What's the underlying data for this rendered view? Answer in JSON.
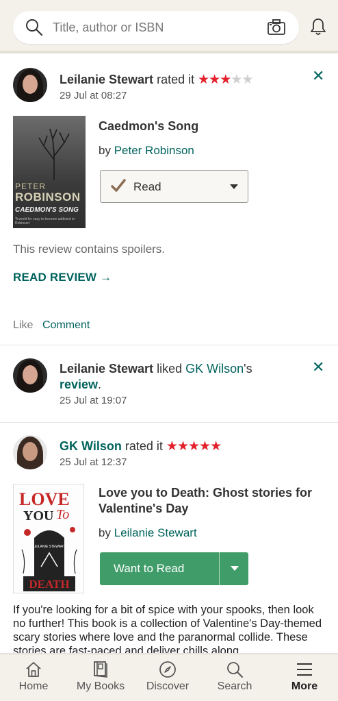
{
  "search": {
    "placeholder": "Title, author or ISBN"
  },
  "feed": {
    "item1": {
      "user": "Leilanie Stewart",
      "action": "rated it",
      "rating": 3,
      "timestamp": "29 Jul at 08:27",
      "book_title": "Caedmon's Song",
      "by": "by",
      "author": "Peter Robinson",
      "cover": {
        "line1": "PETER",
        "line2": "ROBINSON",
        "line3": "CAEDMON'S SONG",
        "line4": "'A world for easy to become addicted to Robinson'"
      },
      "shelf_label": "Read",
      "spoiler_text": "This review contains spoilers.",
      "read_review": "READ REVIEW →",
      "like": "Like",
      "comment": "Comment"
    },
    "item2": {
      "user": "Leilanie Stewart",
      "action": "liked",
      "target_user": "GK Wilson",
      "possessive": "'s",
      "target": "review",
      "period": ".",
      "timestamp": "25 Jul at 19:07"
    },
    "item3": {
      "user": "GK Wilson",
      "action": "rated it",
      "rating": 5,
      "timestamp": "25 Jul at 12:37",
      "book_title_line1": "Love you to Death: Ghost stories for",
      "book_title_line2": "Valentine's Day",
      "by": "by",
      "author": "Leilanie Stewart",
      "cover": {
        "line1": "LOVE",
        "line2": "YOU",
        "line3": "To",
        "line4": "DEATH",
        "line5": "LEILANIE STEWART"
      },
      "shelf_label": "Want to Read",
      "review_text": "If you're looking for a bit of spice with your spooks, then look no further! This book is a collection of Valentine's Day-themed scary stories where love and the paranormal collide. These stories are fast-paced and deliver chills along"
    }
  },
  "colors": {
    "accent": "#00635d",
    "star": "#e3202b",
    "want_to_read": "#409d69",
    "header_bg": "#f4f1ea"
  },
  "nav": [
    {
      "label": "Home",
      "icon": "home-icon"
    },
    {
      "label": "My Books",
      "icon": "books-icon"
    },
    {
      "label": "Discover",
      "icon": "compass-icon"
    },
    {
      "label": "Search",
      "icon": "search-icon"
    },
    {
      "label": "More",
      "icon": "menu-icon"
    }
  ]
}
